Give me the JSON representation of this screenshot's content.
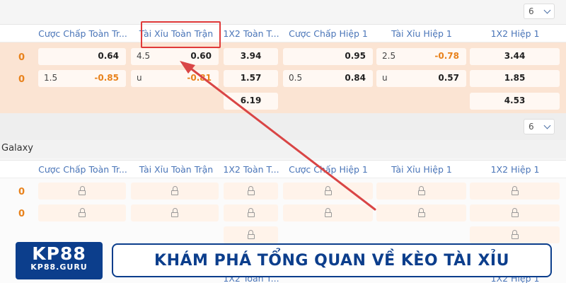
{
  "dropdown_value": "6",
  "columns": [
    "Cược Chấp Toàn Tr...",
    "Tài Xỉu Toàn Trận",
    "1X2 Toàn T...",
    "Cược Chấp Hiệp 1",
    "Tài Xỉu Hiệp 1",
    "1X2 Hiệp 1"
  ],
  "row_labels": [
    "0",
    "0"
  ],
  "odds": {
    "r1": {
      "hc_full": "0.64",
      "ou_full_line": "4.5",
      "ou_full": "0.60",
      "x12_full": "3.94",
      "hc_h1": "0.95",
      "ou_h1_line": "2.5",
      "ou_h1": "-0.78",
      "x12_h1": "3.44"
    },
    "r2": {
      "hc_full_line": "1.5",
      "hc_full": "-0.85",
      "ou_full_line": "u",
      "ou_full": "-0.81",
      "x12_full": "1.57",
      "hc_h1_line": "0.5",
      "hc_h1": "0.84",
      "ou_h1_line": "u",
      "ou_h1": "0.57",
      "x12_h1": "1.85"
    },
    "r3": {
      "x12_full": "6.19",
      "x12_h1": "4.53"
    }
  },
  "section_label": "Galaxy",
  "logo": {
    "line1": "KP88",
    "line2": "KP88.GURU"
  },
  "banner_text": "KHÁM PHÁ TỔNG QUAN VỀ KÈO TÀI XỈU",
  "colors": {
    "accent_orange": "#e8821c",
    "header_blue": "#4a75b8",
    "highlight_red": "#e03a3a",
    "brand_blue": "#0c3e8c"
  }
}
